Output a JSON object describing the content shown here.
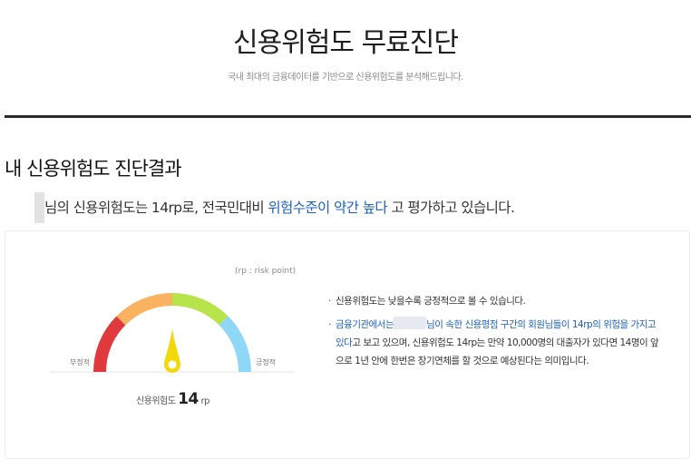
{
  "header": {
    "title": "신용위험도 무료진단",
    "subtitle": "국내 최대의 금융데이터를 기반으로 신용위험도를 분석해드립니다."
  },
  "section": {
    "title": "내 신용위험도 진단결과"
  },
  "result": {
    "text_before": "님의 신용위험도는 14rp로, 전국민대비 ",
    "risk_level": "위험수준이 약간 높다",
    "text_after": " 고 평가하고 있습니다."
  },
  "gauge": {
    "unit_note": "(rp : risk point)",
    "low_label": "부정적",
    "high_label": "긍정적",
    "score_label": "신용위험도",
    "score_value": "14",
    "score_unit": "rp",
    "score": 14,
    "segment_colors": [
      "#e03a3e",
      "#f9b25f",
      "#b7e34b",
      "#8fd7f6"
    ],
    "needle_color": "#f2d90c",
    "baseline_color": "#e6e6e6"
  },
  "info": {
    "item1": "신용위험도는 낮을수록 긍정적으로 볼 수 있습니다.",
    "item2_prefix": "금융기관에서는",
    "item2_blue": "님이 속한 신용평점 구간의 회원님들이 14rp의 위험을 가지고 있다",
    "item2_rest": "고 보고 있으며, 신용위험도 14rp는 만약 10,000명의 대출자가 있다면 14명이 앞으로 1년 안에 한번은 장기연체를 할 것으로 예상된다는 의미입니다."
  },
  "colors": {
    "accent_blue": "#1f62b8",
    "divider": "#2b2b2b"
  }
}
